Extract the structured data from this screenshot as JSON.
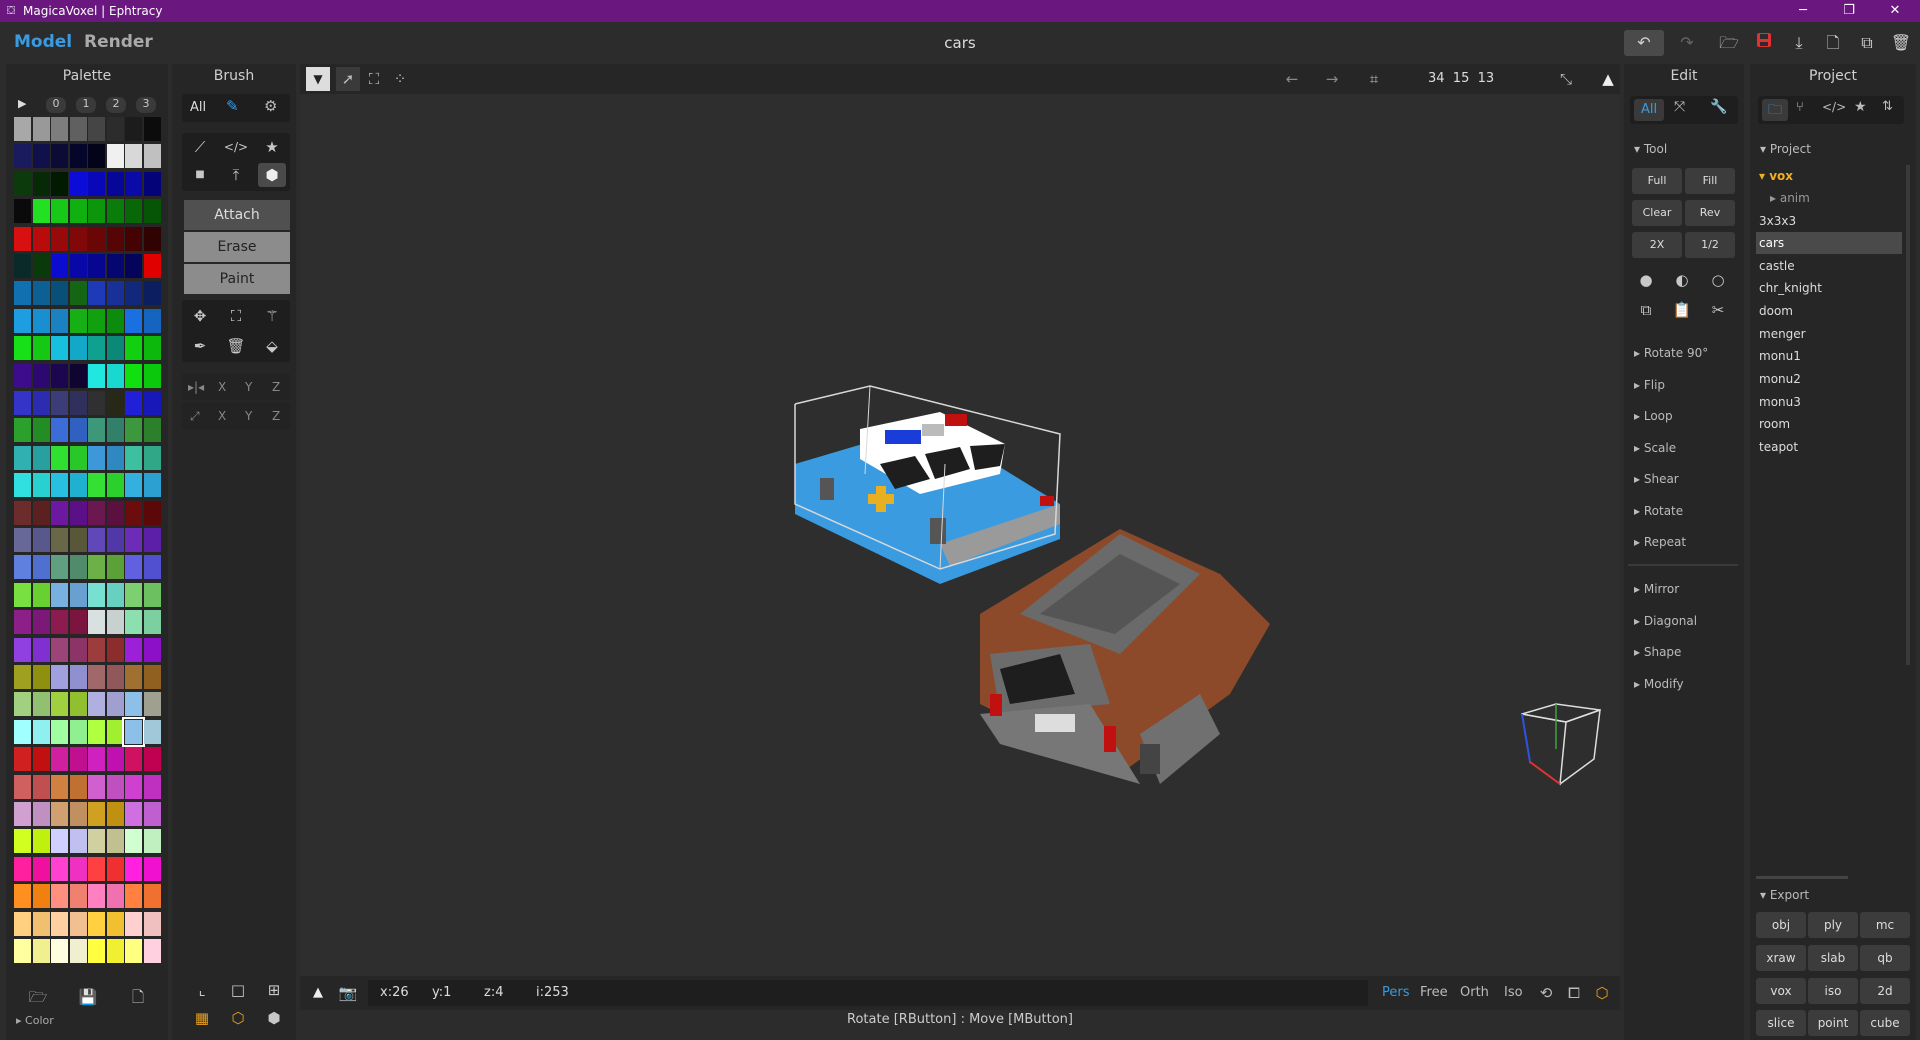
{
  "window": {
    "title": "MagicaVoxel | Ephtracy",
    "minimize": "─",
    "maximize": "❐",
    "close": "✕"
  },
  "header": {
    "tab_model": "Model",
    "tab_render": "Render",
    "document_name": "cars"
  },
  "palette": {
    "title": "Palette",
    "pages": [
      "▶",
      "0",
      "1",
      "2",
      "3"
    ],
    "footer_label": "Color",
    "swatches": [
      [
        "#a8a8a8",
        "#999999",
        "#7d7d7d",
        "#606060",
        "#454545",
        "#2c2c2c",
        "#1c1c1c",
        "#0c0c0c"
      ],
      [
        "#1a1a5e",
        "#10104a",
        "#0b0b36",
        "#06062a",
        "#03031a",
        "#f0f0f0",
        "#d8d8d8",
        "#c0c0c0"
      ],
      [
        "#0c3a0c",
        "#062a06",
        "#021a02",
        "#0c0cd8",
        "#0808b8",
        "#060698",
        "#0a0aa8",
        "#040478"
      ],
      [
        "#0a0a0a",
        "#22e022",
        "#18c818",
        "#10b010",
        "#0c960c",
        "#0a7c0a",
        "#086808",
        "#065406"
      ],
      [
        "#d81010",
        "#b80c0c",
        "#980a0a",
        "#800808",
        "#6a0606",
        "#560404",
        "#440202",
        "#300202"
      ],
      [
        "#0a2a2a",
        "#0a3a0a",
        "#0c0cd0",
        "#0808a8",
        "#060690",
        "#060670",
        "#04045a",
        "#e00000"
      ],
      [
        "#1070b0",
        "#0c6094",
        "#085078",
        "#146614",
        "#1e3ab8",
        "#183098",
        "#12287c",
        "#0c1e60"
      ],
      [
        "#1e9ee0",
        "#1890d0",
        "#1a82c0",
        "#16b016",
        "#10a010",
        "#0c8c0c",
        "#1a70e0",
        "#1464c0"
      ],
      [
        "#18e018",
        "#14c814",
        "#18c0e0",
        "#14a8c8",
        "#10a090",
        "#0c8878",
        "#10d010",
        "#0cb80c"
      ],
      [
        "#3c0c8c",
        "#2c0870",
        "#1c0650",
        "#100430",
        "#20e8e0",
        "#18d8d0",
        "#10e010",
        "#0cc80c"
      ],
      [
        "#3434c8",
        "#2c2cb0",
        "#3c3c78",
        "#30305c",
        "#303030",
        "#282818",
        "#2020d8",
        "#1818b8"
      ],
      [
        "#2ca02c",
        "#248c24",
        "#3c6cd8",
        "#3060c0",
        "#3c9878",
        "#30806a",
        "#3c983c",
        "#2c802c"
      ],
      [
        "#30b0b0",
        "#28a0a0",
        "#30e030",
        "#28c828",
        "#3c98d8",
        "#3088c0",
        "#3cc0a0",
        "#30a888"
      ],
      [
        "#30e0e0",
        "#28d0d0",
        "#28c0e0",
        "#20b0d0",
        "#34e034",
        "#2cd02c",
        "#34b0e0",
        "#2ca0d0"
      ],
      [
        "#6c2c2c",
        "#5c2020",
        "#6c18a0",
        "#5c1088",
        "#6c1850",
        "#5c1040",
        "#6c0c0c",
        "#5c0808"
      ],
      [
        "#686898",
        "#58588c",
        "#686848",
        "#585838",
        "#6048b8",
        "#5038a8",
        "#6c2cb8",
        "#5c20a8"
      ],
      [
        "#6080e0",
        "#5070d0",
        "#60a080",
        "#508c6c",
        "#6cb048",
        "#5ca038",
        "#6060e0",
        "#5050d0"
      ],
      [
        "#78e040",
        "#68d030",
        "#78b0e0",
        "#68a0d0",
        "#78e0d0",
        "#68d0c0",
        "#7cd070",
        "#6cc060"
      ],
      [
        "#8c2088",
        "#7c1878",
        "#8c1c50",
        "#7c1440",
        "#d8e0e0",
        "#c8d0d0",
        "#8ce0b0",
        "#7cd0a0"
      ],
      [
        "#9040e0",
        "#8030d0",
        "#9c4478",
        "#8c3468",
        "#9c3c3c",
        "#8c2c2c",
        "#9c20d8",
        "#8c10c8"
      ],
      [
        "#a0a020",
        "#909010",
        "#a0a0e0",
        "#9090d0",
        "#a06868",
        "#905858",
        "#a07030",
        "#906020"
      ],
      [
        "#a0d080",
        "#90c070",
        "#a0d040",
        "#90c030",
        "#b0b0e0",
        "#a0a0d0",
        "#8cc0e8",
        "#a0a090"
      ],
      [
        "#a0ffff",
        "#90f0f0",
        "#a0ffa0",
        "#90f090",
        "#b0ff40",
        "#a0f030",
        "#b0b0ff",
        "#a0c8d8"
      ],
      [
        "#d02020",
        "#c01010",
        "#d020a0",
        "#c01090",
        "#d020c0",
        "#c010b0",
        "#d01060",
        "#c00050"
      ],
      [
        "#d06060",
        "#c05050",
        "#d08040",
        "#c07030",
        "#d060d0",
        "#c050c0",
        "#d040d0",
        "#c030c0"
      ],
      [
        "#d0a0d0",
        "#c090c0",
        "#d0a070",
        "#c09060",
        "#d0a020",
        "#c09010",
        "#d070e0",
        "#c060d0"
      ],
      [
        "#d0ff20",
        "#c0f010",
        "#d0d0ff",
        "#c0c0f0",
        "#d0d0a0",
        "#c0c090",
        "#d0ffd0",
        "#c0f0c0"
      ],
      [
        "#ff20a0",
        "#f010a0",
        "#ff40d0",
        "#f030c0",
        "#ff4040",
        "#f03030",
        "#ff20e0",
        "#f010d0"
      ],
      [
        "#ff9020",
        "#f08010",
        "#ff9080",
        "#f08070",
        "#ff80c0",
        "#f070b0",
        "#ff8040",
        "#f07030"
      ],
      [
        "#ffd080",
        "#f0c070",
        "#ffd0a0",
        "#f0c090",
        "#ffd040",
        "#f0c030",
        "#ffd0d0",
        "#f0c0c0"
      ],
      [
        "#ffffa0",
        "#f0f090",
        "#ffffe0",
        "#f0f0d0",
        "#ffff40",
        "#f0f030",
        "#ffff80",
        "#ffd0e0"
      ]
    ]
  },
  "brush": {
    "title": "Brush",
    "filter_all": "All",
    "modes": [
      "Attach",
      "Erase",
      "Paint"
    ],
    "mirror_axes": [
      "X",
      "Y",
      "Z"
    ],
    "scale_axes": [
      "X",
      "Y",
      "Z"
    ]
  },
  "viewport": {
    "dimensions": "34  15  13",
    "status": {
      "x": "x:26",
      "y": "y:1",
      "z": "z:4",
      "i": "i:253"
    },
    "hint": "Rotate [RButton] : Move [MButton]",
    "camera_modes": [
      "Pers",
      "Free",
      "Orth",
      "Iso"
    ],
    "active_camera": "Pers"
  },
  "edit": {
    "title": "Edit",
    "filter_all": "All",
    "tool_section": "Tool",
    "tool_buttons": [
      "Full",
      "Fill",
      "Clear",
      "Rev",
      "2X",
      "1/2"
    ],
    "sections_a": [
      "Rotate 90°",
      "Flip",
      "Loop",
      "Scale",
      "Shear",
      "Rotate",
      "Repeat"
    ],
    "sections_b": [
      "Mirror",
      "Diagonal",
      "Shape",
      "Modify"
    ]
  },
  "project": {
    "title": "Project",
    "section": "Project",
    "folder": "vox",
    "subfolder": "anim",
    "files": [
      "3x3x3",
      "cars",
      "castle",
      "chr_knight",
      "doom",
      "menger",
      "monu1",
      "monu2",
      "monu3",
      "room",
      "teapot"
    ],
    "selected_file": "cars",
    "export_section": "Export",
    "export_formats": [
      "obj",
      "ply",
      "mc",
      "xraw",
      "slab",
      "qb",
      "vox",
      "iso",
      "2d",
      "slice",
      "point",
      "cube"
    ]
  },
  "colors": {
    "accent": "#3a9be0",
    "titlebar": "#6b1780",
    "selection": "#4a4a4a",
    "folder": "#f0b020",
    "save_red": "#e03030"
  }
}
